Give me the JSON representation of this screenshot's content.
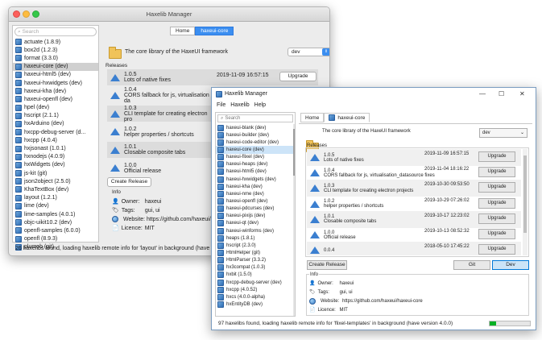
{
  "mac": {
    "title": "Haxelib Manager",
    "search_placeholder": "Search",
    "tabs": [
      "Home",
      "haxeui-core"
    ],
    "libs": [
      "actuate (1.8.9)",
      "box2d (1.2.3)",
      "format (3.3.0)",
      "haxeui-core (dev)",
      "haxeui-html5 (dev)",
      "haxeui-hxwidgets (dev)",
      "haxeui-kha (dev)",
      "haxeui-openfl (dev)",
      "hpel (dev)",
      "hscript (2.1.1)",
      "hxArduino (dev)",
      "hxcpp-debug-server (d...",
      "hxcpp (4.0.4)",
      "hxjsonast (1.0.1)",
      "hxnodejs (4.0.9)",
      "hxWidgets (dev)",
      "js-kit (git)",
      "json2object (2.5.0)",
      "KhaTextBox (dev)",
      "layout (1.2.1)",
      "lime (dev)",
      "lime-samples (4.0.1)",
      "objc-uikit10.2 (dev)",
      "openfl-samples (6.0.0)",
      "openfl (8.9.3)",
      "plumob (git)"
    ],
    "selected_index": 3,
    "header_text": "The core library of the HaxeUI framework",
    "channel": "dev",
    "releases_label": "Releases",
    "releases": [
      {
        "version": "1.0.5",
        "desc": "Lots of native fixes",
        "date": "2019-11-09 16:57:15"
      },
      {
        "version": "1.0.4",
        "desc": "CORS fallback for js, virtualisation  da",
        "date": "2019-11-04 18:16:22"
      },
      {
        "version": "1.0.3",
        "desc": "CLI template for creating electron pro",
        "date": ""
      },
      {
        "version": "1.0.2",
        "desc": "helper properties / shortcuts",
        "date": ""
      },
      {
        "version": "1.0.1",
        "desc": "Closable composite tabs",
        "date": ""
      },
      {
        "version": "1.0.0",
        "desc": "Official release",
        "date": ""
      }
    ],
    "upgrade_label": "Upgrade",
    "create_release": "Create Release",
    "info_label": "Info",
    "info": {
      "owner_label": "Owner:",
      "owner": "haxeui",
      "tags_label": "Tags:",
      "tags": "gui, ui",
      "website_label": "Website:",
      "website": "https://github.com/haxeui/hax",
      "licence_label": "Licence:",
      "licence": "MIT"
    },
    "status": "26 haxelibs found, loading haxelib remote info for 'layout' in background (have versi"
  },
  "win": {
    "title": "Haxelib Manager",
    "menu": [
      "File",
      "Haxelib",
      "Help"
    ],
    "controls": [
      "—",
      "☐",
      "✕"
    ],
    "search_placeholder": "Search",
    "libs": [
      "haxeui-blank (dev)",
      "haxeui-builder (dev)",
      "haxeui-code-editor (dev)",
      "haxeui-core (dev)",
      "haxeui-flixel (dev)",
      "haxeui-heaps (dev)",
      "haxeui-html5 (dev)",
      "haxeui-hxwidgets (dev)",
      "haxeui-kha (dev)",
      "haxeui-nme (dev)",
      "haxeui-openfl (dev)",
      "haxeui-pdcurses (dev)",
      "haxeui-pixijs (dev)",
      "haxeui-qt (dev)",
      "haxeui-winforms (dev)",
      "heaps (1.8.1)",
      "hscript (2.3.0)",
      "HtmlHelper (git)",
      "HtmlParser (3.3.2)",
      "hx3compat (1.0.3)",
      "hxbit (1.5.0)",
      "hxcpp-debug-server (dev)",
      "hxcpp (4.0.52)",
      "hxcs (4.0.0-alpha)",
      "hxEntityDB (dev)"
    ],
    "selected_index": 3,
    "tabs": [
      "Home",
      "haxeui-core"
    ],
    "header_text": "The core library of the HaxeUI framework",
    "channel": "dev",
    "releases_label": "Releases",
    "releases": [
      {
        "version": "1.0.5",
        "desc": "Lots of native fixes",
        "date": "2019-11-09 16:57:15"
      },
      {
        "version": "1.0.4",
        "desc": "CORS fallback for js, virtualisation_datasource fixes",
        "date": "2019-11-04 18:16:22"
      },
      {
        "version": "1.0.3",
        "desc": "CLI template for creating electron projects",
        "date": "2019-10-30 09:53:50"
      },
      {
        "version": "1.0.2",
        "desc": "helper properties / shortcuts",
        "date": "2019-10-29 07:26:02"
      },
      {
        "version": "1.0.1",
        "desc": "Closable composite tabs",
        "date": "2019-10-17 12:23:02"
      },
      {
        "version": "1.0.0",
        "desc": "Official release",
        "date": "2019-10-13 08:52:32"
      },
      {
        "version": "0.0.4",
        "desc": "",
        "date": "2018-05-10 17:45:22"
      }
    ],
    "upgrade_label": "Upgrade",
    "create_release": "Create Release",
    "git_label": "Git",
    "dev_label": "Dev",
    "info_label": "Info",
    "info": {
      "owner_label": "Owner:",
      "owner": "haxeui",
      "tags_label": "Tags:",
      "tags": "gui, ui",
      "website_label": "Website:",
      "website": "https://github.com/haxeui/haxeui-core",
      "licence_label": "Licence:",
      "licence": "MIT"
    },
    "status": "97 haxelibs found, loading haxelib remote info for 'flixel-templates' in background (have version 4.0.0)",
    "progress": 0.15
  },
  "colors": {
    "accent": "#3b8ef0",
    "progress": "#06b025"
  }
}
